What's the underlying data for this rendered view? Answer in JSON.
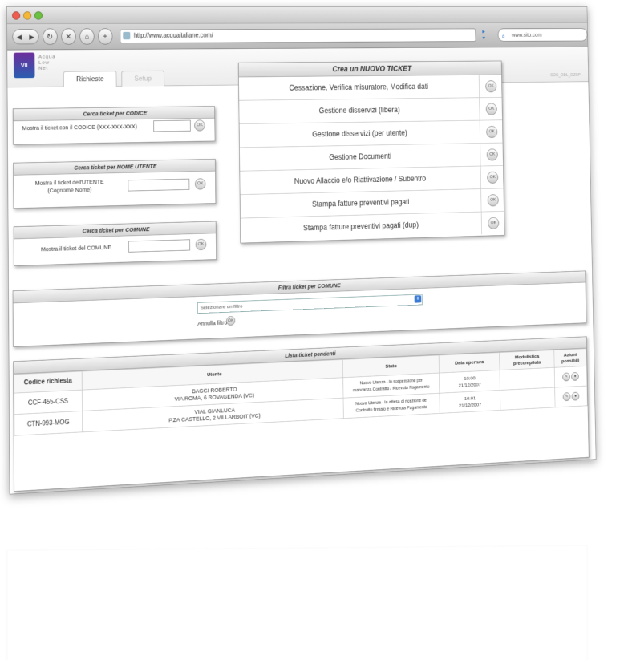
{
  "browser": {
    "url": "http://www.acquaitaliane.com/",
    "search_text": "www.sito.com",
    "back_icon": "back-icon",
    "forward_icon": "forward-icon"
  },
  "app": {
    "logo_text": "VII",
    "logo_caption": "Acqua Low Net",
    "tabs": [
      {
        "label": "Richieste",
        "active": true
      },
      {
        "label": "Setup",
        "active": false
      }
    ],
    "version": "SOS_ODL_DZSP"
  },
  "search_code": {
    "title": "Cerca ticket per CODICE",
    "label": "Mostra il ticket con il CODICE (XXX-XXX-XXX)",
    "button": "OK"
  },
  "search_user": {
    "title": "Cerca ticket per NOME UTENTE",
    "label_line1": "Mostra il ticket dell'UTENTE",
    "label_line2": "(Cognome Nome)",
    "button": "OK"
  },
  "search_comune": {
    "title": "Cerca ticket per COMUNE",
    "label": "Mostra il ticket del COMUNE",
    "button": "OK"
  },
  "new_ticket": {
    "title_prefix": "Crea un ",
    "title_bold": "NUOVO TICKET",
    "items": [
      {
        "label": "Cessazione, Verifica misuratore, Modifica dati",
        "button": "OK"
      },
      {
        "label": "Gestione disservizi (libera)",
        "button": "OK"
      },
      {
        "label": "Gestione disservizi (per utente)",
        "button": "OK"
      },
      {
        "label": "Gestione Documenti",
        "button": "OK"
      },
      {
        "label": "Nuovo Allaccio e/o Riattivazione / Subentro",
        "button": "OK"
      },
      {
        "label": "Stampa fatture preventivi pagati",
        "button": "OK"
      },
      {
        "label": "Stampa fatture preventivi pagati (dup)",
        "button": "OK"
      }
    ]
  },
  "filter": {
    "title": "Filtra ticket per COMUNE",
    "select_value": "Selezionare un filtro",
    "cancel_label": "Annulla filtro",
    "button": "OK"
  },
  "tickets": {
    "title": "Lista ticket pendenti",
    "columns": [
      "Codice richiesta",
      "Utente",
      "Stato",
      "Data apertura",
      "Modulistica precompilata",
      "Azioni possibili"
    ],
    "rows": [
      {
        "code": "CCF-455-CSS",
        "user_line1": "BAGGI   ROBERTO",
        "user_line2": "VIA ROMA, 6 ROVAGENDA (VC)",
        "status_line1": "Nuovo Utenza - In sospensione per",
        "status_line2": "mancanza Contratto / Ricevuta Pagamento",
        "date_line1": "10:00",
        "date_line2": "21/12/2007"
      },
      {
        "code": "CTN-993-MOG",
        "user_line1": "VIAL   GIANLUCA",
        "user_line2": "P.ZA CASTELLO, 2 VILLARBOIT (VC)",
        "status_line1": "Nuova Utenza - In attesa di ricezione del",
        "status_line2": "Contratto firmato e Ricevuta Pagamento",
        "date_line1": "10:01",
        "date_line2": "21/12/2007"
      }
    ]
  }
}
